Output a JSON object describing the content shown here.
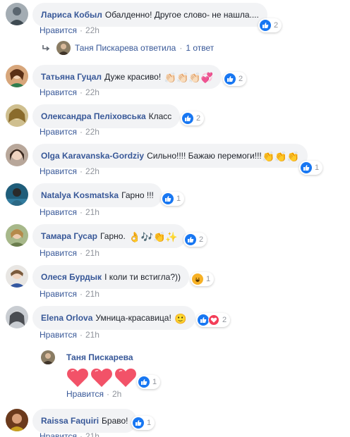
{
  "colors": {
    "link": "#385898",
    "bubble": "#f2f3f5",
    "like": "#1877f2",
    "love": "#f33e58",
    "meta": "#90949c"
  },
  "labels": {
    "like": "Нравится",
    "dot": "·"
  },
  "comments": [
    {
      "name": "Лариса Кобыл",
      "text": "Обалденно! Другое слово- не нашла....",
      "emoji": "",
      "time": "22h",
      "reactions": "2"
    },
    {
      "name": "Татьяна Гуцал",
      "text": "Дуже красиво!",
      "emoji": "👏🏻👏🏻👏🏻💞",
      "time": "22h",
      "reactions": "2"
    },
    {
      "name": "Олександра Пеліховська",
      "text": "Класс",
      "emoji": "",
      "time": "22h",
      "reactions": "2"
    },
    {
      "name": "Olga Karavanska-Gordziy",
      "text": "Сильно!!!! Бажаю перемоги!!!",
      "emoji": "👏👏👏",
      "time": "22h",
      "reactions": "1"
    },
    {
      "name": "Natalya Kosmatska",
      "text": "Гарно !!!",
      "emoji": "",
      "time": "21h",
      "reactions": "1"
    },
    {
      "name": "Тамара Гусар",
      "text": "Гарно.",
      "emoji": "👌🎶👏✨",
      "time": "21h",
      "reactions": "2"
    },
    {
      "name": "Олеся Бурдык",
      "text": "І коли ти встигла?))",
      "emoji": "",
      "time": "21h",
      "reactions": "1"
    },
    {
      "name": "Elena Orlova",
      "text": "Умница-красавица!",
      "emoji": "🙂",
      "time": "21h",
      "reactions": "2"
    },
    {
      "name": "Raissa Faquiri",
      "text": "Браво!",
      "emoji": "",
      "time": "21h",
      "reactions": "1"
    }
  ],
  "reply_summary": {
    "name": "Таня Пискарева",
    "action": "ответила",
    "count": "1 ответ"
  },
  "reply": {
    "name": "Таня Пискарева",
    "time": "2h",
    "reactions": "1"
  }
}
